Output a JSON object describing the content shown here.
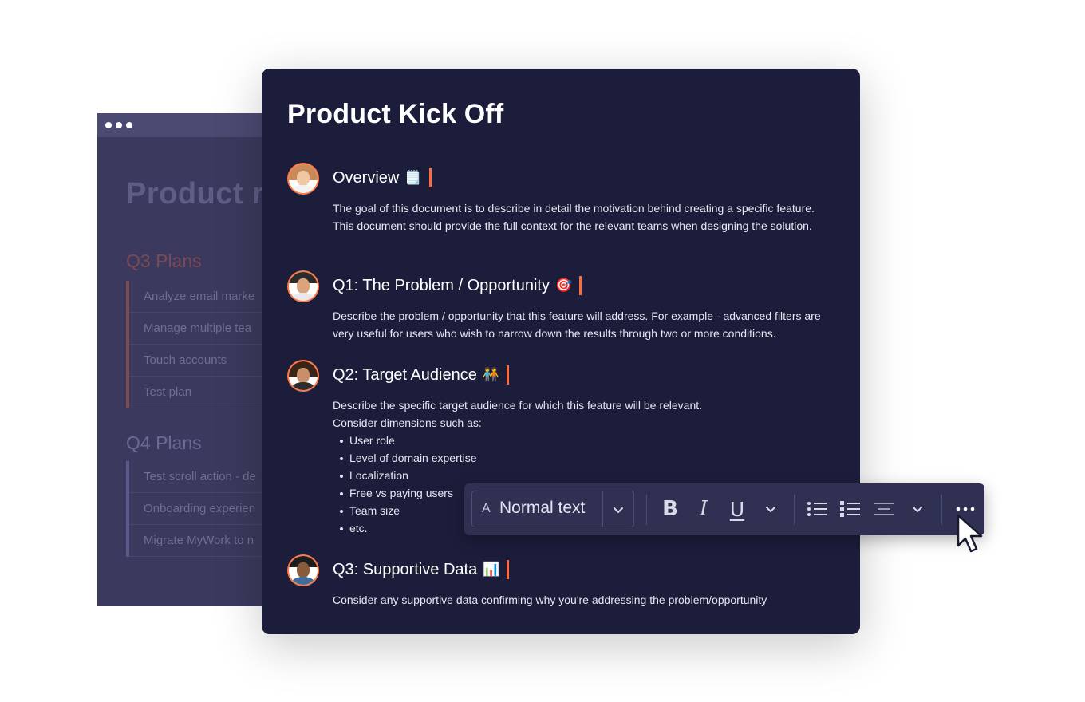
{
  "background_window": {
    "title": "Product r",
    "q3_heading": "Q3 Plans",
    "q3_items": [
      "Analyze email marke",
      "Manage multiple tea",
      "Touch accounts",
      "Test plan"
    ],
    "q4_heading": "Q4 Plans",
    "q4_items": [
      "Test scroll action - de",
      "Onboarding experien",
      "Migrate MyWork to n"
    ]
  },
  "doc": {
    "title": "Product Kick Off",
    "sections": [
      {
        "heading": "Overview",
        "emoji": "🗒️",
        "avatar": "woman-avatar",
        "body": "The goal of this document is to describe in detail the motivation behind creating a specific feature. This document should provide the full context for the relevant teams when designing the solution."
      },
      {
        "heading": "Q1: The Problem / Opportunity",
        "emoji": "🎯",
        "avatar": "man-avatar",
        "body": "Describe the problem / opportunity that this feature will address. For example - advanced filters are very useful for users who wish to narrow down the results through two or more conditions."
      },
      {
        "heading": "Q2: Target Audience",
        "emoji": "🧑‍🤝‍🧑",
        "avatar": "woman-avatar",
        "body_line1": "Describe the specific target audience for which this feature will be relevant.",
        "body_line2": "Consider dimensions such as:",
        "bullets": [
          "User role",
          "Level of domain expertise",
          "Localization",
          "Free vs paying users",
          "Team size",
          "etc."
        ]
      },
      {
        "heading": "Q3: Supportive Data",
        "emoji": "📊",
        "avatar": "man-avatar",
        "body": "Consider any supportive data confirming why you're addressing the problem/opportunity"
      }
    ]
  },
  "toolbar": {
    "text_style_glyph": "A",
    "text_style": "Normal text",
    "bold": "B",
    "italic": "I",
    "underline": "U"
  },
  "colors": {
    "card_bg": "#1c1d3b",
    "accent": "#ff6b3d",
    "toolbar_bg": "#303152"
  }
}
